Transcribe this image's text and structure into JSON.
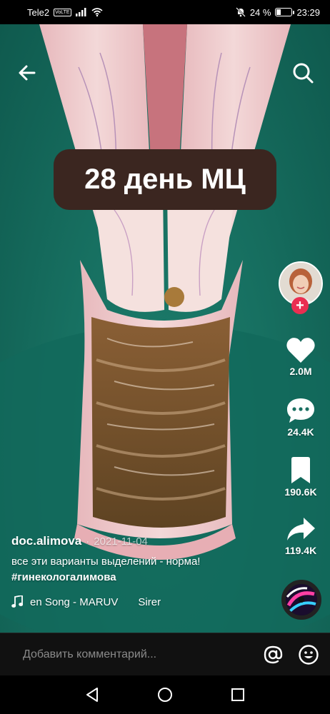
{
  "status_bar": {
    "carrier": "Tele2",
    "volte": "VoLTE",
    "battery_percent": "24 %",
    "battery_level": 0.24,
    "time": "23:29",
    "icons": [
      "signal-icon",
      "wifi-icon",
      "mute-icon",
      "battery-icon"
    ]
  },
  "video": {
    "caption": "28 день МЦ",
    "colors": {
      "background": "#177061",
      "caption_box": "#3b2620",
      "tissue_pink": "#e7aeb4",
      "discharge_brown": "#7b5a2a"
    }
  },
  "top_actions": {
    "back_icon": "arrow-left-icon",
    "search_icon": "search-icon"
  },
  "right_rail": {
    "follow_icon": "plus-icon",
    "likes": "2.0M",
    "comments": "24.4K",
    "bookmarks": "190.6K",
    "shares": "119.4K",
    "follow_color": "#ea2e51"
  },
  "post": {
    "author": "doc.alimova",
    "separator": "·",
    "date": "2021-11-04",
    "description": "все эти варианты выделений - норма! ",
    "hashtag": "#гинекологалимова",
    "sound_text": "en Song - MARUV",
    "sound_text_2": "Sirer",
    "music_icon": "music-note-icon"
  },
  "comment_bar": {
    "placeholder": "Добавить комментарий...",
    "mention_icon": "at-sign-icon",
    "emoji_icon": "emoji-icon"
  },
  "nav_bar": {
    "back": "triangle-back-icon",
    "home": "circle-home-icon",
    "recents": "square-recents-icon"
  }
}
